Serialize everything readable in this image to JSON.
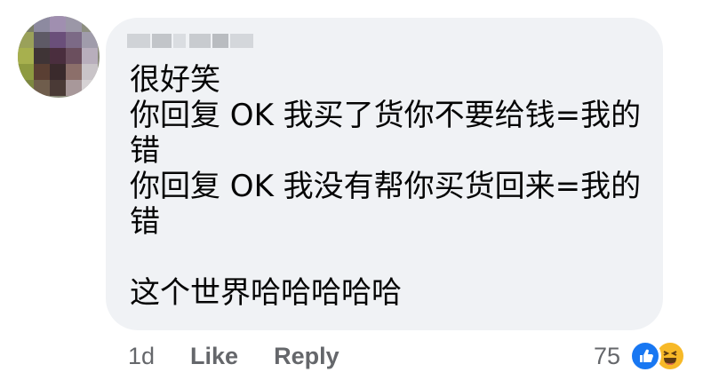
{
  "comment": {
    "author_name": "",
    "body": "很好笑\n你回复 OK 我买了货你不要给钱=我的\n错\n你回复 OK 我没有帮你买货回来=我的\n错\n\n这个世界哈哈哈哈哈",
    "timestamp": "1d",
    "like_label": "Like",
    "reply_label": "Reply",
    "reaction_count": "75",
    "reactions": [
      "like-icon",
      "haha-icon"
    ]
  },
  "colors": {
    "bubble": "#f0f2f5",
    "secondary_text": "#65676b",
    "like_blue": "#1877f2",
    "haha_yellow": "#f7b928"
  }
}
